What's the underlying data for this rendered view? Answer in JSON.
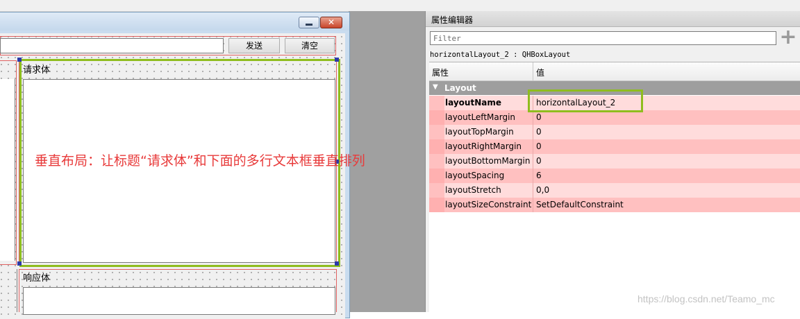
{
  "form": {
    "send_button": "发送",
    "clear_button": "清空",
    "request_label": "请求体",
    "response_label": "响应体",
    "close_glyph": "✕",
    "annotation": "垂直布局：让标题“请求体”和下面的多行文本框垂直排列"
  },
  "editor": {
    "title": "属性编辑器",
    "filter_placeholder": "Filter",
    "add_glyph": "+",
    "object_line": "horizontalLayout_2 : QHBoxLayout",
    "col_property": "属性",
    "col_value": "值",
    "group": {
      "arrow": "▼",
      "name": "Layout"
    },
    "properties": [
      {
        "name": "layoutName",
        "value": "horizontalLayout_2"
      },
      {
        "name": "layoutLeftMargin",
        "value": "0"
      },
      {
        "name": "layoutTopMargin",
        "value": "0"
      },
      {
        "name": "layoutRightMargin",
        "value": "0"
      },
      {
        "name": "layoutBottomMargin",
        "value": "0"
      },
      {
        "name": "layoutSpacing",
        "value": "6"
      },
      {
        "name": "layoutStretch",
        "value": "0,0"
      },
      {
        "name": "layoutSizeConstraint",
        "value": "SetDefaultConstraint"
      }
    ]
  },
  "watermark": "https://blog.csdn.net/Teamo_mc",
  "colors": {
    "highlight_green": "#8fbd1e",
    "layout_red": "#e06060",
    "annotation_red": "#e83a3a",
    "row_pink": "#ffdcdc",
    "row_pink_alt": "#ffc0c0",
    "group_grey": "#9e9e9e"
  }
}
